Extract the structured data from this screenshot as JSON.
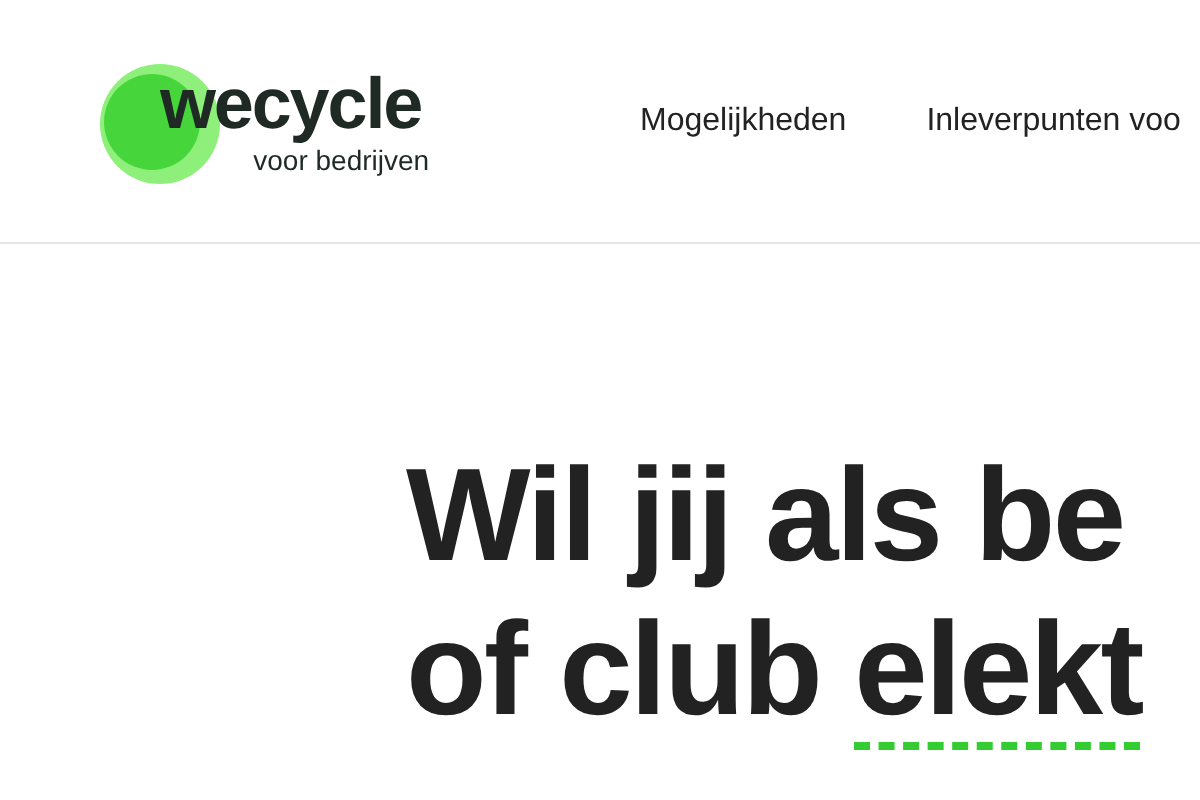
{
  "header": {
    "logo": {
      "name": "wecycle",
      "tagline": "voor bedrijven"
    },
    "nav": [
      {
        "label": "Mogelijkheden"
      },
      {
        "label": "Inleverpunten voo"
      }
    ]
  },
  "hero": {
    "headline_lines": [
      [
        {
          "text": "Wil jij als be",
          "highlighted": false
        }
      ],
      [
        {
          "text": "of club ",
          "highlighted": false
        },
        {
          "text": "elekt",
          "highlighted": true
        }
      ]
    ]
  }
}
